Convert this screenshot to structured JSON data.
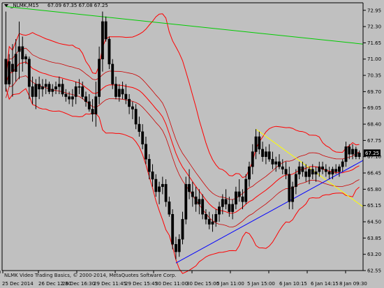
{
  "header": {
    "symbol": "_NLMK,M15",
    "ohlc": "67.09 67.35 67.08 67.25",
    "symbol_arrow_icon": "triangle-down-icon"
  },
  "copyright": "NLMK Video Trading Basics, © 2000-2014, MetaQuotes Software Corp.",
  "colors": {
    "background": "#c0c0c0",
    "candle": "#000000",
    "bollinger": "#ff0000",
    "envelope": "#cc0000",
    "green_line": "#00cc00",
    "yellow_line": "#ffff00",
    "blue_line": "#0000ff",
    "price_tag": "#000000"
  },
  "chart_data": {
    "type": "candlestick",
    "title": "_NLMK,M15",
    "ylim": [
      62.55,
      73.25
    ],
    "grid": false,
    "price_tag": "67.25",
    "y_ticks": [
      "72.95",
      "72.30",
      "71.65",
      "71.00",
      "70.35",
      "69.70",
      "69.05",
      "68.40",
      "67.75",
      "67.25",
      "67.10",
      "66.45",
      "65.80",
      "65.15",
      "64.50",
      "63.85",
      "63.20",
      "62.55"
    ],
    "x_ticks": [
      "25 Dec 2014",
      "26 Dec 12:30",
      "26 Dec 16:30",
      "29 Dec 11:45",
      "29 Dec 15:45",
      "30 Dec 11:00",
      "30 Dec 15:00",
      "5 Jan 11:00",
      "5 Jan 15:00",
      "6 Jan 10:15",
      "6 Jan 14:15",
      "8 Jan 09:30"
    ],
    "candles": [
      [
        71.0,
        72.9,
        69.7,
        70.0
      ],
      [
        70.0,
        71.2,
        69.9,
        70.9
      ],
      [
        70.8,
        71.6,
        69.5,
        70.5
      ],
      [
        70.5,
        71.8,
        70.1,
        71.2
      ],
      [
        71.3,
        72.5,
        70.2,
        71.5
      ],
      [
        71.5,
        71.9,
        70.5,
        71.0
      ],
      [
        71.0,
        71.2,
        70.8,
        71.1
      ],
      [
        71.0,
        71.1,
        69.4,
        69.9
      ],
      [
        69.9,
        70.3,
        69.2,
        69.5
      ],
      [
        69.5,
        70.2,
        69.0,
        70.0
      ],
      [
        70.0,
        70.3,
        69.4,
        69.8
      ],
      [
        69.8,
        70.2,
        69.5,
        69.9
      ],
      [
        69.9,
        70.2,
        69.6,
        70.0
      ],
      [
        70.0,
        70.1,
        69.6,
        69.7
      ],
      [
        69.7,
        70.0,
        69.5,
        69.8
      ],
      [
        69.8,
        70.1,
        69.6,
        69.9
      ],
      [
        69.9,
        70.3,
        69.6,
        70.0
      ],
      [
        70.0,
        70.2,
        69.5,
        69.6
      ],
      [
        69.6,
        69.8,
        69.3,
        69.5
      ],
      [
        69.5,
        69.7,
        69.2,
        69.4
      ],
      [
        69.4,
        69.8,
        69.1,
        69.5
      ],
      [
        69.5,
        70.1,
        69.2,
        69.9
      ],
      [
        69.9,
        70.2,
        69.6,
        69.9
      ],
      [
        69.9,
        70.1,
        69.4,
        69.5
      ],
      [
        69.5,
        69.7,
        69.1,
        69.3
      ],
      [
        69.3,
        69.6,
        68.9,
        69.0
      ],
      [
        69.0,
        69.4,
        68.5,
        68.8
      ],
      [
        68.8,
        70.1,
        68.3,
        69.5
      ],
      [
        69.5,
        71.5,
        69.2,
        71.0
      ],
      [
        71.0,
        72.9,
        70.5,
        72.5
      ],
      [
        72.5,
        72.7,
        71.7,
        71.8
      ],
      [
        71.8,
        71.9,
        70.6,
        70.8
      ],
      [
        70.8,
        71.0,
        69.8,
        70.0
      ],
      [
        70.0,
        70.3,
        69.4,
        69.5
      ],
      [
        69.5,
        70.0,
        69.3,
        69.8
      ],
      [
        69.8,
        70.1,
        69.4,
        69.6
      ],
      [
        69.6,
        70.0,
        69.2,
        69.4
      ],
      [
        69.4,
        69.6,
        68.8,
        69.1
      ],
      [
        69.1,
        69.3,
        68.6,
        69.0
      ],
      [
        69.0,
        69.2,
        68.2,
        68.4
      ],
      [
        68.4,
        68.7,
        67.9,
        68.1
      ],
      [
        68.1,
        68.4,
        67.4,
        67.6
      ],
      [
        67.6,
        67.9,
        66.8,
        67.0
      ],
      [
        67.0,
        67.2,
        66.2,
        66.5
      ],
      [
        66.5,
        66.8,
        65.9,
        66.2
      ],
      [
        66.2,
        66.4,
        65.5,
        65.7
      ],
      [
        65.7,
        66.1,
        65.2,
        65.9
      ],
      [
        65.9,
        66.3,
        65.6,
        66.0
      ],
      [
        66.0,
        66.2,
        65.1,
        65.3
      ],
      [
        65.3,
        65.5,
        64.7,
        64.8
      ],
      [
        64.8,
        65.0,
        63.4,
        63.6
      ],
      [
        63.6,
        63.9,
        63.0,
        63.3
      ],
      [
        63.3,
        64.0,
        63.1,
        63.8
      ],
      [
        63.8,
        64.9,
        63.6,
        64.6
      ],
      [
        64.6,
        66.3,
        64.4,
        66.0
      ],
      [
        66.0,
        66.6,
        65.4,
        65.7
      ],
      [
        65.7,
        66.1,
        65.1,
        65.5
      ],
      [
        65.5,
        65.9,
        64.9,
        65.2
      ],
      [
        65.2,
        65.8,
        64.8,
        65.4
      ],
      [
        65.4,
        65.6,
        64.6,
        64.8
      ],
      [
        64.8,
        65.0,
        64.4,
        64.6
      ],
      [
        64.6,
        64.9,
        64.2,
        64.4
      ],
      [
        64.4,
        64.8,
        64.1,
        64.5
      ],
      [
        64.5,
        65.0,
        64.3,
        64.8
      ],
      [
        64.8,
        65.3,
        64.5,
        65.1
      ],
      [
        65.1,
        65.6,
        64.8,
        65.4
      ],
      [
        65.4,
        65.8,
        65.0,
        65.2
      ],
      [
        65.2,
        65.5,
        64.7,
        64.9
      ],
      [
        64.9,
        65.4,
        64.6,
        65.2
      ],
      [
        65.2,
        65.9,
        65.0,
        65.7
      ],
      [
        65.7,
        66.2,
        65.3,
        65.5
      ],
      [
        65.5,
        65.8,
        65.0,
        65.3
      ],
      [
        65.3,
        66.4,
        65.2,
        66.2
      ],
      [
        66.2,
        66.9,
        65.9,
        66.7
      ],
      [
        66.7,
        67.6,
        66.4,
        67.3
      ],
      [
        67.3,
        68.2,
        67.0,
        67.9
      ],
      [
        67.9,
        68.1,
        67.2,
        67.4
      ],
      [
        67.4,
        67.7,
        66.9,
        67.1
      ],
      [
        67.1,
        67.5,
        66.8,
        67.3
      ],
      [
        67.3,
        67.6,
        66.9,
        67.0
      ],
      [
        67.0,
        67.3,
        66.6,
        66.8
      ],
      [
        66.8,
        67.1,
        66.5,
        66.9
      ],
      [
        66.9,
        67.2,
        66.6,
        66.7
      ],
      [
        66.7,
        67.0,
        66.4,
        66.6
      ],
      [
        66.6,
        66.9,
        66.2,
        66.4
      ],
      [
        66.4,
        66.7,
        65.0,
        65.3
      ],
      [
        65.3,
        66.1,
        65.0,
        65.9
      ],
      [
        65.9,
        66.6,
        65.6,
        66.4
      ],
      [
        66.4,
        66.9,
        66.2,
        66.7
      ],
      [
        66.7,
        66.9,
        66.3,
        66.5
      ],
      [
        66.5,
        66.8,
        66.1,
        66.3
      ],
      [
        66.3,
        66.7,
        66.0,
        66.6
      ],
      [
        66.6,
        66.8,
        66.2,
        66.4
      ],
      [
        66.4,
        66.7,
        66.1,
        66.5
      ],
      [
        66.5,
        66.9,
        66.3,
        66.7
      ],
      [
        66.7,
        66.9,
        66.4,
        66.6
      ],
      [
        66.6,
        66.8,
        66.3,
        66.5
      ],
      [
        66.5,
        66.7,
        66.2,
        66.4
      ],
      [
        66.4,
        66.7,
        66.2,
        66.6
      ],
      [
        66.6,
        66.8,
        66.4,
        66.5
      ],
      [
        66.5,
        66.8,
        66.3,
        66.7
      ],
      [
        66.7,
        67.0,
        66.5,
        66.9
      ],
      [
        66.9,
        67.7,
        66.7,
        67.5
      ],
      [
        67.5,
        67.6,
        67.0,
        67.2
      ],
      [
        67.2,
        67.6,
        67.0,
        67.4
      ],
      [
        67.4,
        67.5,
        67.0,
        67.1
      ],
      [
        67.1,
        67.35,
        67.0,
        67.25
      ]
    ],
    "indicators": [
      "bollinger_bands",
      "envelope_bands"
    ],
    "trendlines": [
      "green_resistance",
      "yellow_channel",
      "blue_support"
    ]
  }
}
